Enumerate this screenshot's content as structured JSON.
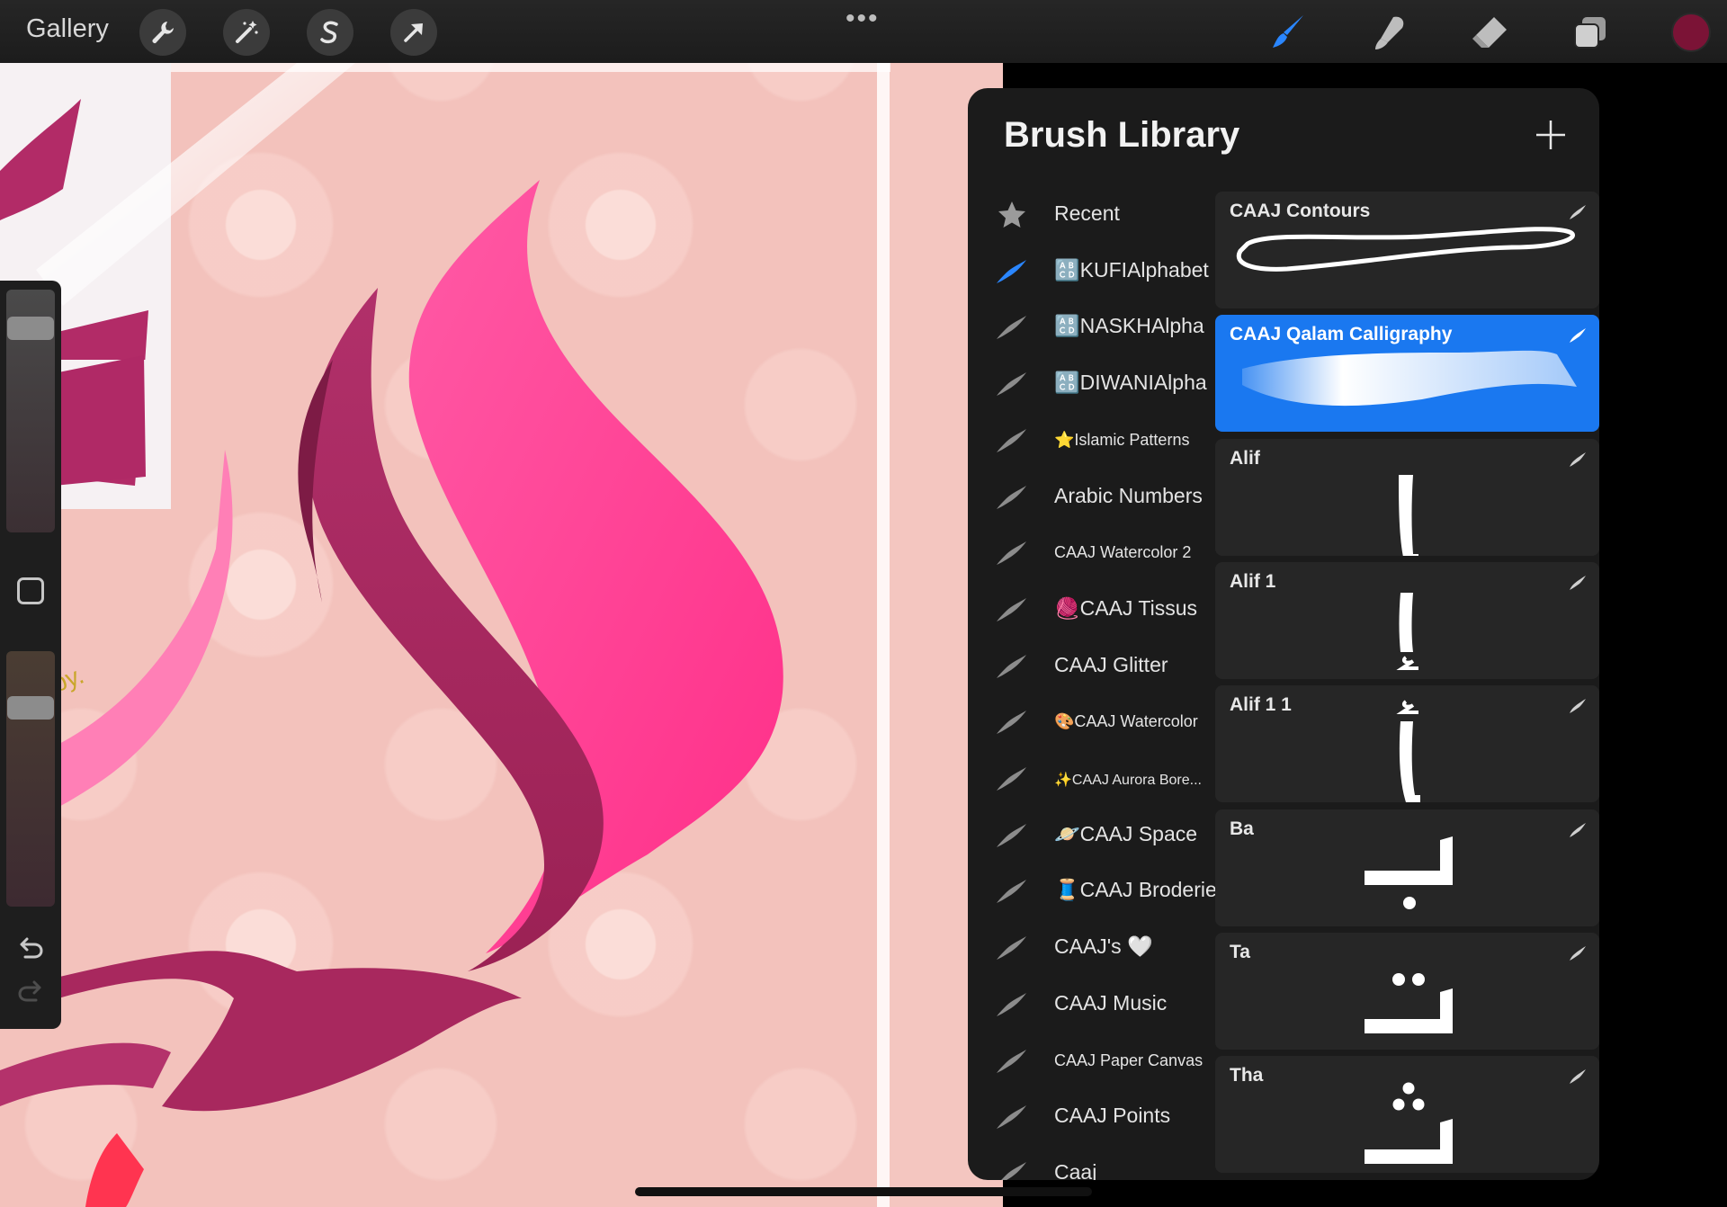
{
  "toolbar": {
    "gallery_label": "Gallery",
    "left_tools": [
      "wrench-icon",
      "magic-wand-icon",
      "selection-s-icon",
      "move-arrow-icon"
    ],
    "more_label": "•••",
    "right_tools": [
      "brush-icon",
      "smudge-icon",
      "eraser-icon",
      "layers-icon"
    ],
    "current_color": "#7b1336"
  },
  "sidebar": {
    "brush_size_level": 0.08,
    "opacity_level": 0.2
  },
  "brush_library": {
    "title": "Brush Library",
    "add_label": "+",
    "sets": [
      {
        "label": "Recent",
        "icon": "star-icon"
      },
      {
        "label": "🔠KUFIAlphabet",
        "icon": "brush-stroke-icon"
      },
      {
        "label": "🔠NASKHAlpha",
        "icon": "brush-stroke-icon"
      },
      {
        "label": "🔠DIWANIAlpha",
        "icon": "brush-stroke-icon"
      },
      {
        "label": "⭐Islamic Patterns",
        "icon": "brush-stroke-icon"
      },
      {
        "label": "Arabic Numbers",
        "icon": "brush-stroke-icon"
      },
      {
        "label": "CAAJ Watercolor 2",
        "icon": "brush-stroke-icon"
      },
      {
        "label": "🧶CAAJ Tissus",
        "icon": "brush-stroke-icon"
      },
      {
        "label": "CAAJ Glitter",
        "icon": "brush-stroke-icon"
      },
      {
        "label": "🎨CAAJ Watercolor",
        "icon": "brush-stroke-icon"
      },
      {
        "label": "✨CAAJ Aurora Bore...",
        "icon": "brush-stroke-icon"
      },
      {
        "label": "🪐CAAJ Space",
        "icon": "brush-stroke-icon"
      },
      {
        "label": "🧵CAAJ Broderie",
        "icon": "brush-stroke-icon"
      },
      {
        "label": "CAAJ's 🤍",
        "icon": "brush-stroke-icon"
      },
      {
        "label": "CAAJ Music",
        "icon": "brush-stroke-icon"
      },
      {
        "label": "CAAJ Paper Canvas",
        "icon": "brush-stroke-icon"
      },
      {
        "label": "CAAJ Points",
        "icon": "brush-stroke-icon"
      },
      {
        "label": "Caaj",
        "icon": "brush-stroke-icon"
      }
    ],
    "active_set": "🔠KUFIAlphabet",
    "brushes": [
      {
        "name": "CAAJ Contours",
        "preview": "contour-stroke"
      },
      {
        "name": "CAAJ Qalam Calligraphy",
        "preview": "qalam-stroke",
        "selected": true
      },
      {
        "name": "Alif",
        "preview": "arabic-letter-alif"
      },
      {
        "name": "Alif  1",
        "preview": "arabic-letter-alif-hamza-below"
      },
      {
        "name": "Alif  1 1",
        "preview": "arabic-letter-alif-hamza-above"
      },
      {
        "name": "Ba",
        "preview": "arabic-letter-ba"
      },
      {
        "name": "Ta",
        "preview": "arabic-letter-ta"
      },
      {
        "name": "Tha",
        "preview": "arabic-letter-tha"
      }
    ]
  },
  "colors": {
    "accent": "#1a78f0",
    "panel": "#1b1b1b",
    "card": "#262626",
    "canvas_bg": "#f3c2bc",
    "pink": "#ff4f9a",
    "magenta": "#a8285e"
  }
}
